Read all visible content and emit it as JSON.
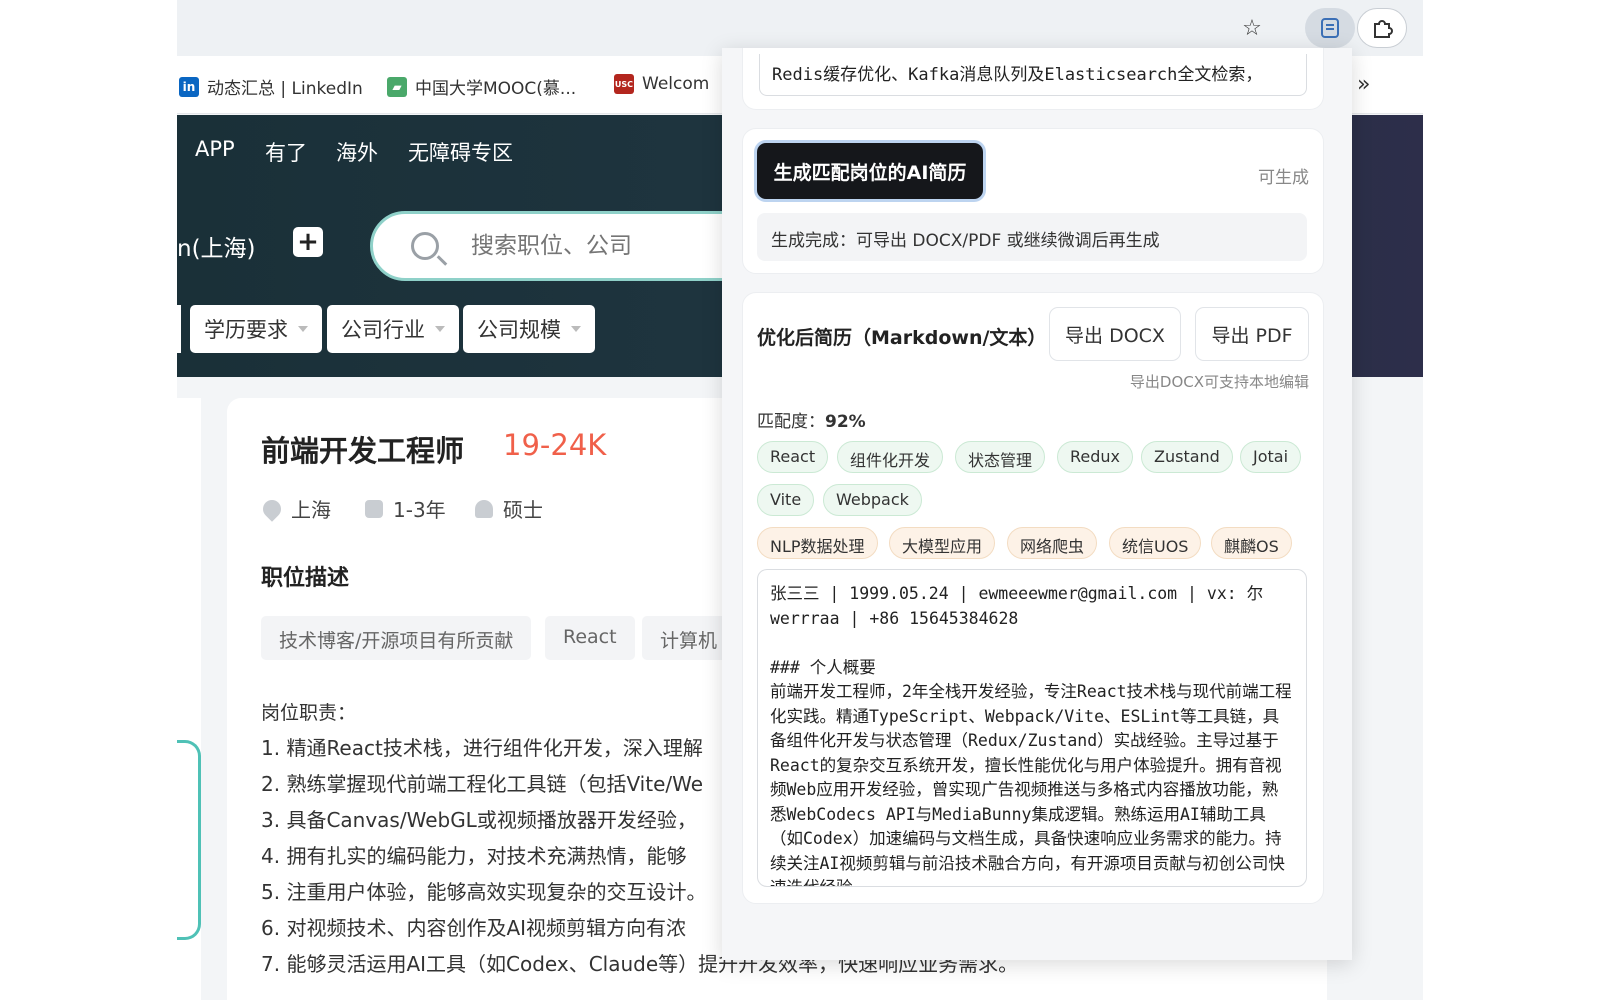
{
  "browser": {
    "toolbar": {
      "star_icon": "star-icon",
      "reader_icon": "reader-icon",
      "extension_icon": "puzzle-icon"
    },
    "bookmarks": [
      {
        "label": "动态汇总 | LinkedIn",
        "icon": "in",
        "color": "#0a66c2"
      },
      {
        "label": "中国大学MOOC(慕...",
        "icon": "▰",
        "color": "#4aa86a"
      },
      {
        "label": "Welcom",
        "icon": "USC",
        "color": "#b3261e"
      }
    ],
    "more_icon": "»"
  },
  "page": {
    "nav": [
      "APP",
      "有了",
      "海外",
      "无障碍专区"
    ],
    "city": "n(上海)",
    "city_add_icon": "+",
    "search": {
      "placeholder": "搜索职位、公司"
    },
    "filters": [
      "学历要求",
      "公司行业",
      "公司规模"
    ],
    "job": {
      "title": "前端开发工程师",
      "salary": "19-24K",
      "location": "上海",
      "experience": "1-3年",
      "education": "硕士",
      "section_title": "职位描述",
      "tags": [
        "技术博客/开源项目有所贡献",
        "React",
        "计算机"
      ],
      "responsibilities_heading": "岗位职责：",
      "responsibilities": [
        "1. 精通React技术栈，进行组件化开发，深入理解",
        "2. 熟练掌握现代前端工程化工具链（包括Vite/We",
        "3. 具备Canvas/WebGL或视频播放器开发经验，",
        "4. 拥有扎实的编码能力，对技术充满热情，能够",
        "5. 注重用户体验，能够高效实现复杂的交互设计。",
        "6. 对视频技术、内容创作及AI视频剪辑方向有浓",
        "7. 能够灵活运用AI工具（如Codex、Claude等）提升开发效率，快速响应业务需求。"
      ]
    }
  },
  "panel": {
    "top_text": "Redis缓存优化、Kafka消息队列及Elasticsearch全文检索，",
    "generate_button": "生成匹配岗位的AI简历",
    "generate_available": "可生成",
    "generate_status": "生成完成：可导出 DOCX/PDF 或继续微调后再生成",
    "resume_title": "优化后简历（Markdown/文本）",
    "export_docx": "导出 DOCX",
    "export_pdf": "导出 PDF",
    "export_hint": "导出DOCX可支持本地编辑",
    "match_label": "匹配度：",
    "match_value": "92%",
    "skills_matched": [
      "React",
      "组件化开发",
      "状态管理",
      "Redux",
      "Zustand",
      "Jotai",
      "Vite",
      "Webpack"
    ],
    "skills_extra": [
      "NLP数据处理",
      "大模型应用",
      "网络爬虫",
      "统信UOS",
      "麒麟OS"
    ],
    "resume_text": "张三三 | 1999.05.24 | ewmeeewmer@gmail.com | vx: 尔werrraa | +86 15645384628\n\n### 个人概要\n前端开发工程师，2年全栈开发经验，专注React技术栈与现代前端工程化实践。精通TypeScript、Webpack/Vite、ESLint等工具链，具备组件化开发与状态管理（Redux/Zustand）实战经验。主导过基于React的复杂交互系统开发，擅长性能优化与用户体验提升。拥有音视频Web应用开发经验，曾实现广告视频推送与多格式内容播放功能，熟悉WebCodecs API与MediaBunny集成逻辑。熟练运用AI辅助工具（如Codex）加速编码与文档生成，具备快速响应业务需求的能力。持续关注AI视频剪辑与前沿技术融合方向，有开源项目贡献与初创公司快速迭代经验。"
  }
}
